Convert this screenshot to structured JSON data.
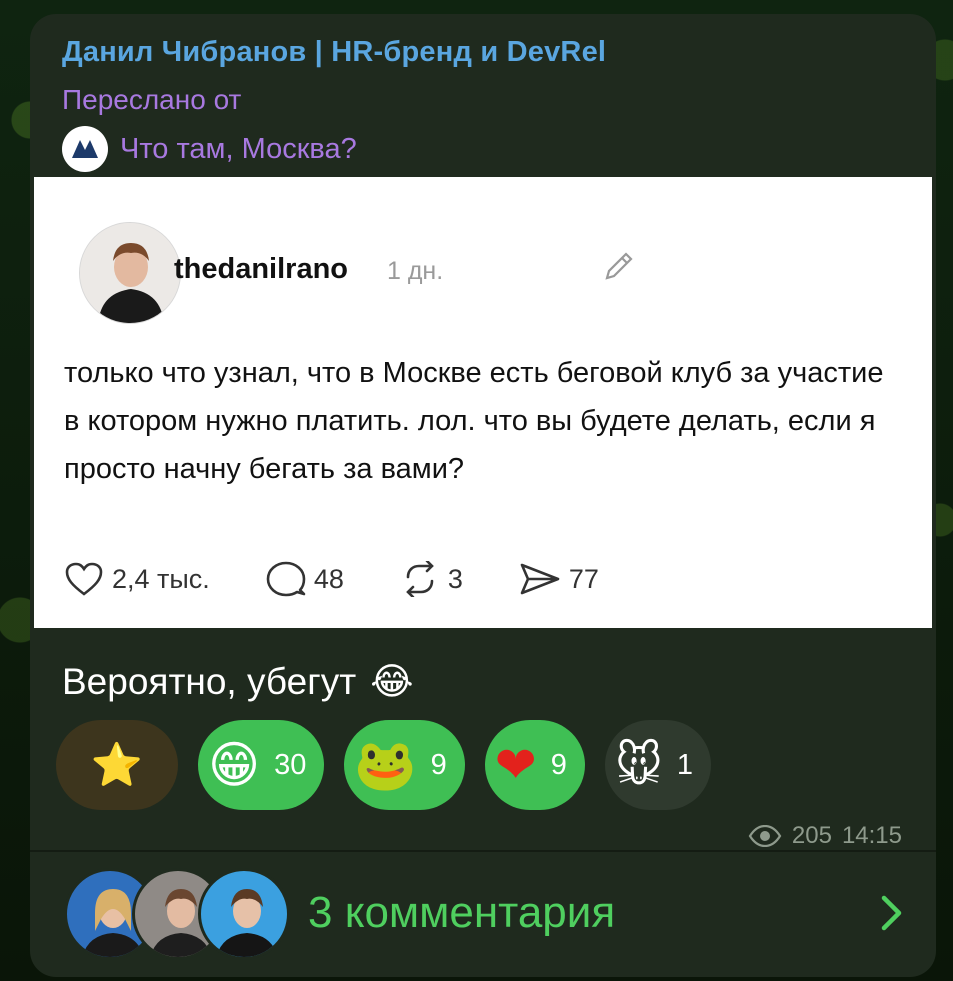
{
  "message": {
    "channel_title": "Данил Чибранов | HR-бренд и DevRel",
    "forwarded_label": "Переслано от",
    "forwarded_source": "Что там, Москва?",
    "caption": "Вероятно, убегут",
    "caption_emoji": "😂"
  },
  "post": {
    "username": "thedanilrano",
    "time": "1 дн.",
    "text": "только что узнал, что в Москве есть беговой клуб за участие в котором нужно платить. лол. что вы будете делать, если я просто начну бегать за вами?",
    "likes": "2,4 тыс.",
    "comments": "48",
    "reposts": "3",
    "shares": "77"
  },
  "reactions": [
    {
      "emoji": "⭐",
      "count": ""
    },
    {
      "emoji": "😁",
      "count": "30"
    },
    {
      "emoji": "🐸",
      "count": "9"
    },
    {
      "emoji": "❤",
      "count": "9"
    },
    {
      "emoji": "🐭",
      "count": "1"
    }
  ],
  "meta": {
    "views": "205",
    "time": "14:15"
  },
  "comments": {
    "label": "3 комментария"
  },
  "colors": {
    "accent_green": "#3fbf54",
    "channel_blue": "#5aa6e0",
    "forward_purple": "#a879e0"
  }
}
